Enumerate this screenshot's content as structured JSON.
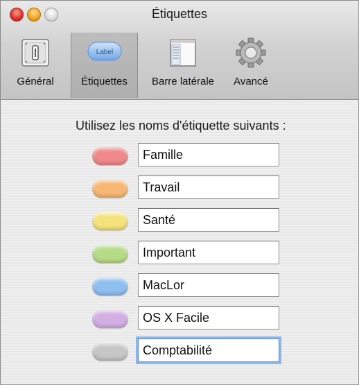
{
  "window": {
    "title": "Étiquettes"
  },
  "toolbar": {
    "items": [
      {
        "label": "Général",
        "icon": "general-switch-icon"
      },
      {
        "label": "Étiquettes",
        "icon": "label-pill-icon",
        "icon_text": "Label"
      },
      {
        "label": "Barre latérale",
        "icon": "sidebar-window-icon"
      },
      {
        "label": "Avancé",
        "icon": "gear-icon"
      }
    ],
    "selected_index": 1
  },
  "content": {
    "prompt": "Utilisez les noms d'étiquette suivants :",
    "labels": [
      {
        "name": "Famille",
        "color": "#f08a8a"
      },
      {
        "name": "Travail",
        "color": "#f7b874"
      },
      {
        "name": "Santé",
        "color": "#f4e37c"
      },
      {
        "name": "Important",
        "color": "#b7dc87"
      },
      {
        "name": "MacLor",
        "color": "#8fbff0"
      },
      {
        "name": "OS X Facile",
        "color": "#d3aee3"
      },
      {
        "name": "Comptabilité",
        "color": "#c7c7c7"
      }
    ]
  }
}
